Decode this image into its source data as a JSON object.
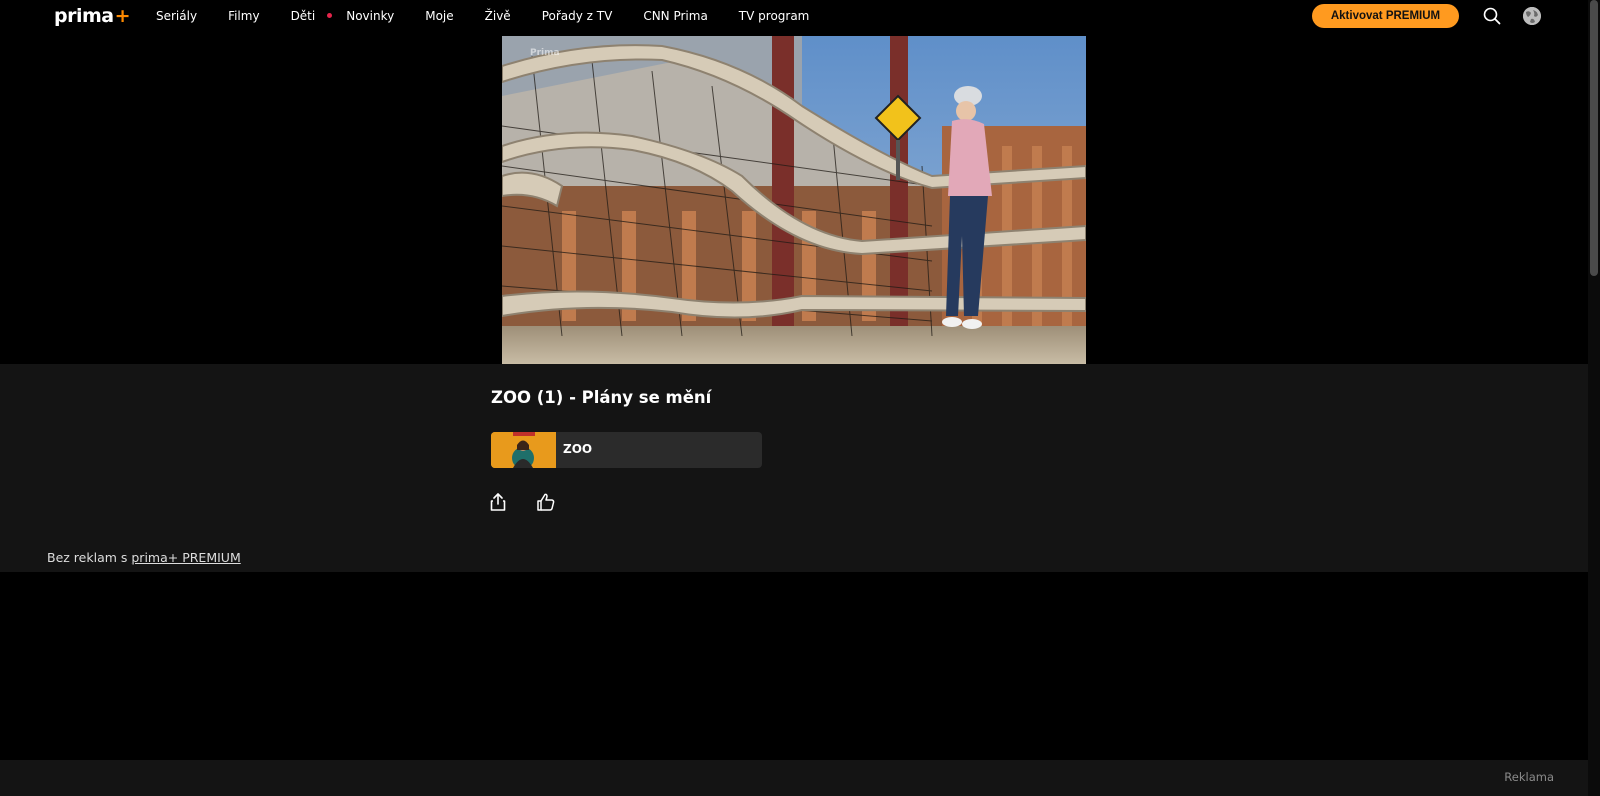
{
  "header": {
    "logo_text": "prima",
    "logo_plus": "+",
    "nav": [
      "Seriály",
      "Filmy",
      "Děti",
      "Novinky",
      "Moje",
      "Živě",
      "Pořady z TV",
      "CNN Prima",
      "TV program"
    ],
    "premium_label": "Aktivovat PREMIUM",
    "search_icon": "search-icon",
    "avatar_icon": "user-avatar-icon"
  },
  "player": {
    "watermark": "Prima"
  },
  "episode": {
    "title": "ZOO (1) - Plány se mění",
    "show_name": "ZOO",
    "share_icon": "share-icon",
    "like_icon": "thumbs-up-icon"
  },
  "promo": {
    "prefix": "Bez reklam s",
    "link": "prima+ PREMIUM"
  },
  "ad": {
    "label": "Reklama"
  },
  "colors": {
    "accent": "#ff9a1f",
    "live_dot": "#e5254b",
    "panel": "#141414",
    "card": "#2b2b2b"
  }
}
